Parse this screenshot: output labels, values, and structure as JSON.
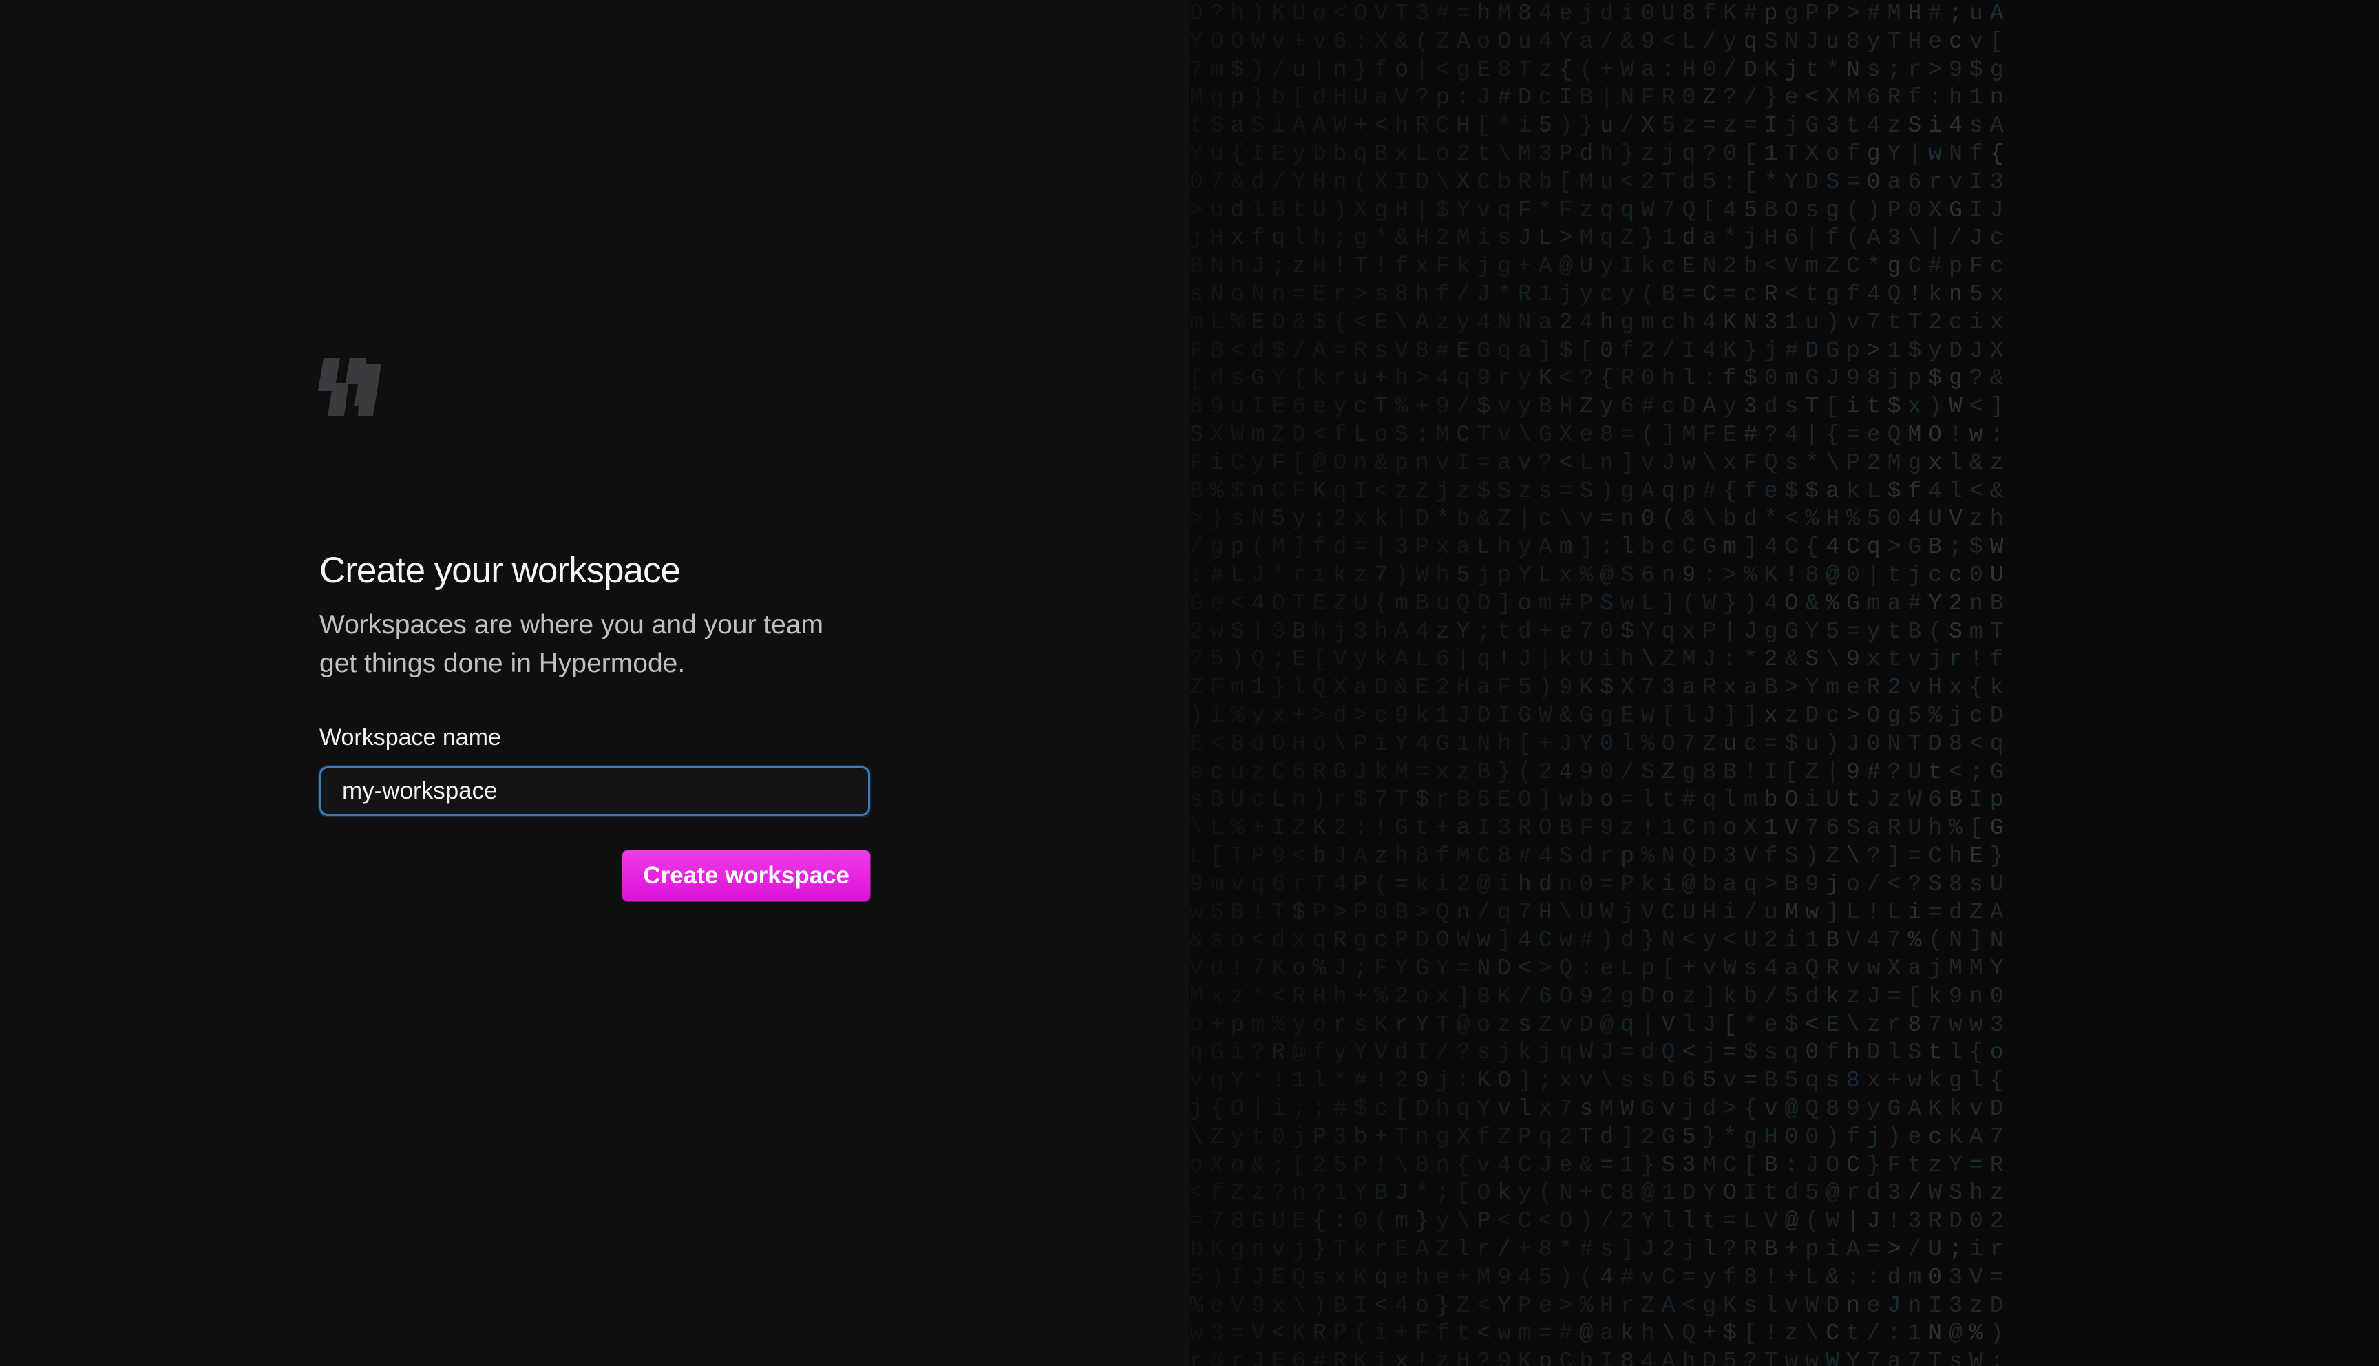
{
  "brand": {
    "logo_icon": "hypermode-logo-icon"
  },
  "onboarding": {
    "title": "Create your workspace",
    "subtitle": "Workspaces are where you and your team get things done in Hypermode.",
    "workspace_field": {
      "label": "Workspace name",
      "value": "my-workspace",
      "placeholder": ""
    },
    "submit_label": "Create workspace"
  },
  "colors": {
    "accent": "#e620e0",
    "focus_ring": "#3a7bbd",
    "background": "#0e0e0f"
  }
}
